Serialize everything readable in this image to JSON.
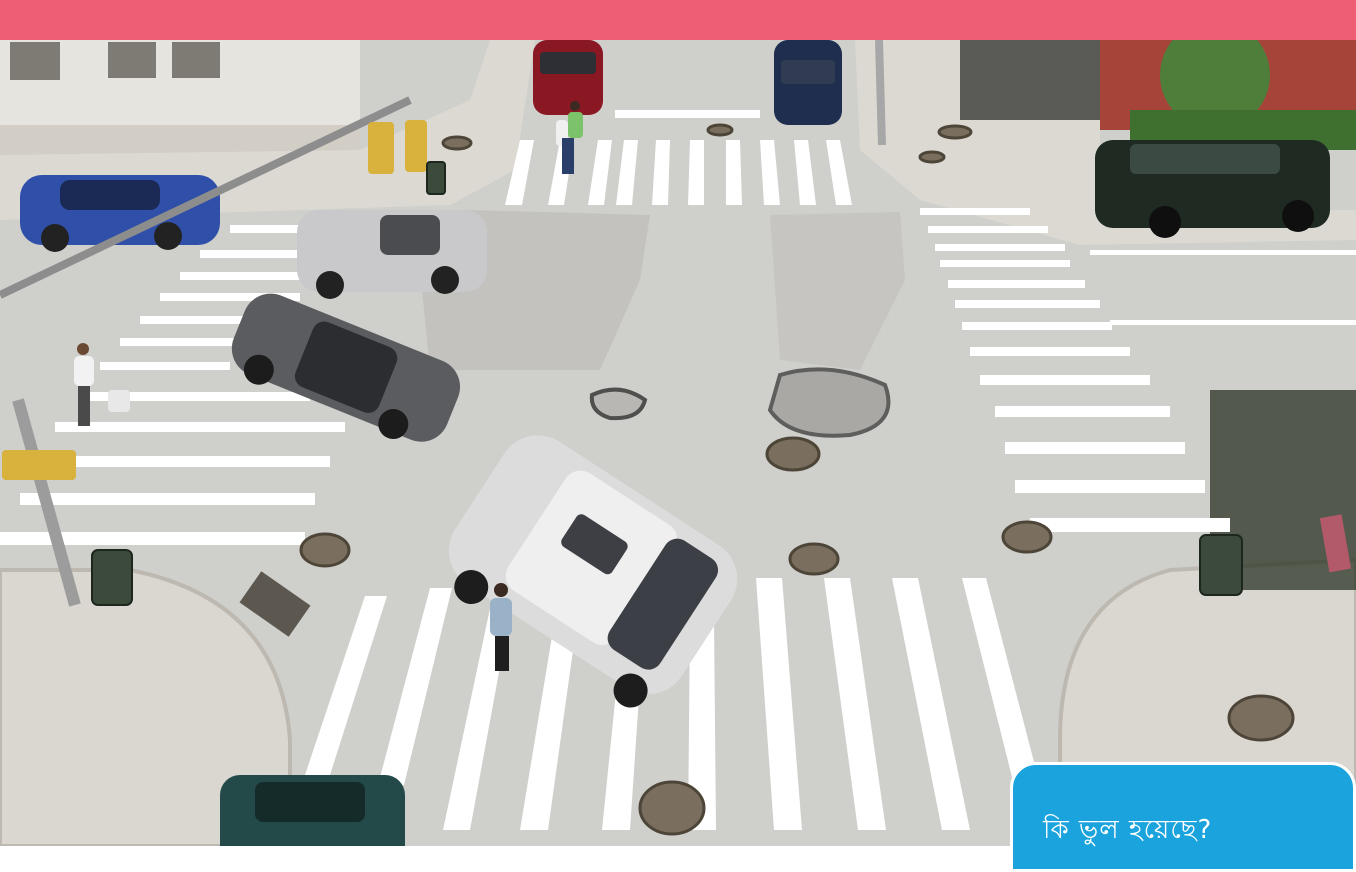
{
  "header": {
    "color": "#ee5f74"
  },
  "scene": {
    "description_icon": "street-intersection-photo",
    "colors": {
      "road": "#cfcfcc",
      "sidewalk": "#d9d6d0",
      "stripe": "#ffffff"
    }
  },
  "callout": {
    "text": "কি ভুল হয়েছে?",
    "background": "#1aa3dc"
  }
}
